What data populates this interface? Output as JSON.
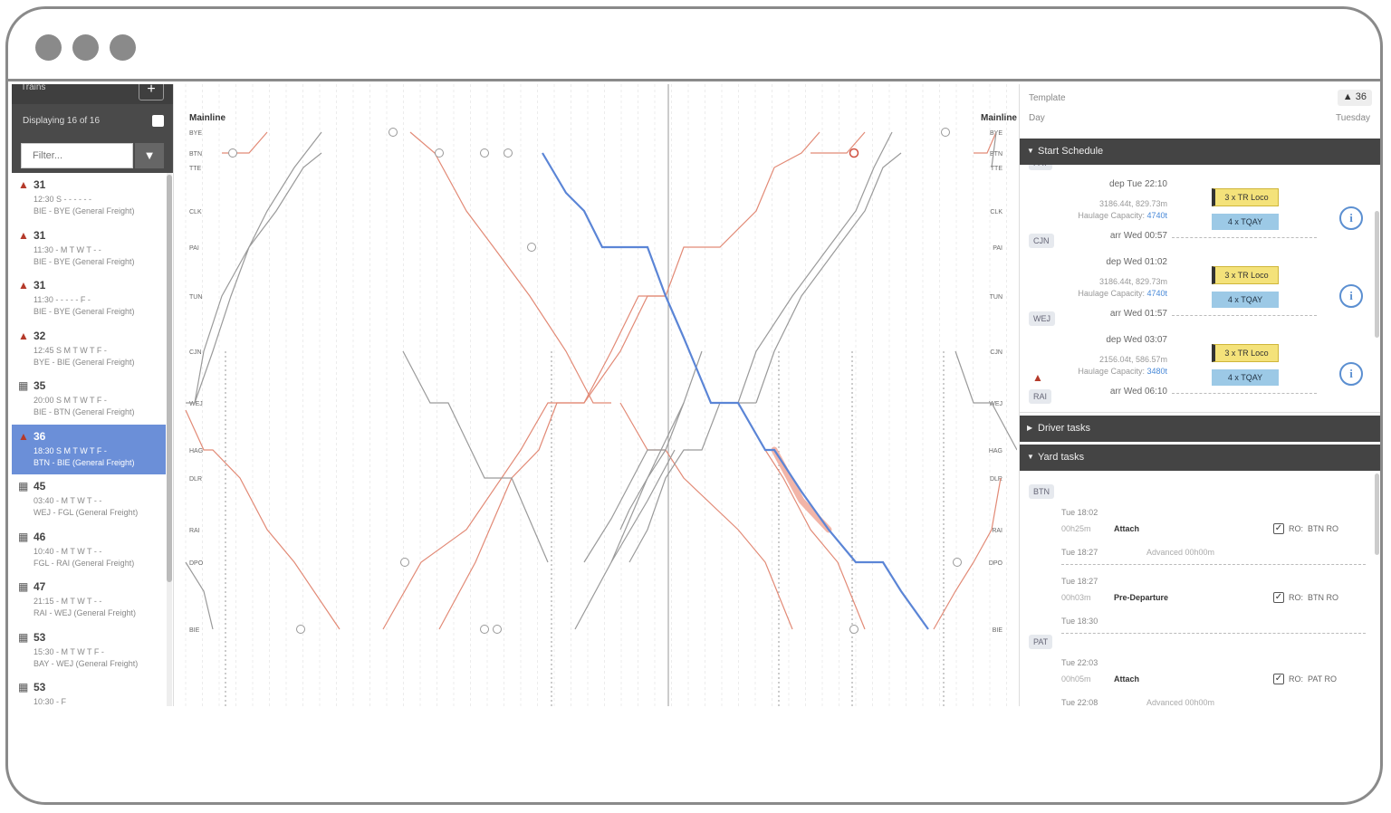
{
  "sidebar": {
    "header_label": "Trains",
    "add_label": "+",
    "displaying": "Displaying 16 of 16",
    "filter_placeholder": "Filter...",
    "trains": [
      {
        "icon": "warning",
        "num": "31",
        "l1": "12:30  S  -  -  -  -  -  -",
        "l2": "BIE - BYE (General Freight)"
      },
      {
        "icon": "warning",
        "num": "31",
        "l1": "11:30  -  M T W T  -  -",
        "l2": "BIE - BYE (General Freight)"
      },
      {
        "icon": "warning",
        "num": "31",
        "l1": "11:30  -  -  -  -  -  F  -",
        "l2": "BIE - BYE (General Freight)"
      },
      {
        "icon": "warning",
        "num": "32",
        "l1": "12:45  S M T W T F  -",
        "l2": "BYE - BIE (General Freight)"
      },
      {
        "icon": "loco",
        "num": "35",
        "l1": "20:00  S M T W T F  -",
        "l2": "BIE - BTN (General Freight)"
      },
      {
        "icon": "warning",
        "num": "36",
        "l1": "18:30  S M T W T F  -",
        "l2": "BTN - BIE (General Freight)",
        "active": true
      },
      {
        "icon": "loco",
        "num": "45",
        "l1": "03:40  -  M T W T  -  -",
        "l2": "WEJ - FGL (General Freight)"
      },
      {
        "icon": "loco",
        "num": "46",
        "l1": "10:40  -  M T W T  -  -",
        "l2": "FGL - RAI (General Freight)"
      },
      {
        "icon": "loco",
        "num": "47",
        "l1": "21:15  -  M T W T  -  -",
        "l2": "RAI - WEJ (General Freight)"
      },
      {
        "icon": "loco",
        "num": "53",
        "l1": "15:30  -  M T W T F  -",
        "l2": "BAY - WEJ (General Freight)"
      },
      {
        "icon": "loco",
        "num": "53",
        "l1": "10:30  -  F",
        "l2": ""
      }
    ]
  },
  "chart": {
    "left_title": "Mainline",
    "right_title": "Mainline",
    "stations": [
      "BYE",
      "BTN",
      "TTE",
      "CLK",
      "PAI",
      "TUN",
      "CJN",
      "WEJ",
      "HAG",
      "DLR",
      "RAI",
      "DPO",
      "BIE"
    ]
  },
  "panel": {
    "template_label": "Template",
    "badge_count": "36",
    "day_label": "Day",
    "day_value": "Tuesday",
    "start_schedule": "Start Schedule",
    "legs": [
      {
        "top_station": "PAT",
        "dep": "dep Tue 22:10",
        "weight": "3186.44t, 829.73m",
        "capacity_label": "Haulage Capacity:",
        "capacity": "4740t",
        "arr": "arr Wed 00:57",
        "loco": "3 x TR Loco",
        "wagons": "4 x TQAY"
      },
      {
        "top_station": "CJN",
        "dep": "dep Wed 01:02",
        "weight": "3186.44t, 829.73m",
        "capacity_label": "Haulage Capacity:",
        "capacity": "4740t",
        "arr": "arr Wed 01:57",
        "loco": "3 x TR Loco",
        "wagons": "4 x TQAY"
      },
      {
        "top_station": "WEJ",
        "dep": "dep Wed 03:07",
        "weight": "2156.04t, 586.57m",
        "capacity_label": "Haulage Capacity:",
        "capacity": "3480t",
        "arr": "arr Wed 06:10",
        "loco": "3 x TR Loco",
        "wagons": "4 x TQAY"
      }
    ],
    "last_station": "RAI",
    "driver_tasks": "Driver tasks",
    "yard_tasks": "Yard tasks",
    "yard": [
      {
        "station": "BTN",
        "tasks": [
          {
            "start": "Tue 18:02",
            "dur": "00h25m",
            "name": "Attach",
            "end": "Tue 18:27",
            "note": "Advanced 00h00m",
            "ro_label": "RO:",
            "ro": "BTN RO"
          },
          {
            "start": "Tue 18:27",
            "dur": "00h03m",
            "name": "Pre-Departure",
            "end": "Tue 18:30",
            "note": "",
            "ro_label": "RO:",
            "ro": "BTN RO"
          }
        ]
      },
      {
        "station": "PAT",
        "tasks": [
          {
            "start": "Tue 22:03",
            "dur": "00h05m",
            "name": "Attach",
            "end": "Tue 22:08",
            "note": "Advanced 00h00m",
            "ro_label": "RO:",
            "ro": "PAT RO"
          }
        ]
      }
    ]
  },
  "colors": {
    "selected": "#5b85d6",
    "warning": "#b53a2a",
    "other": "#e28a76",
    "grey": "#9a9a9a"
  }
}
